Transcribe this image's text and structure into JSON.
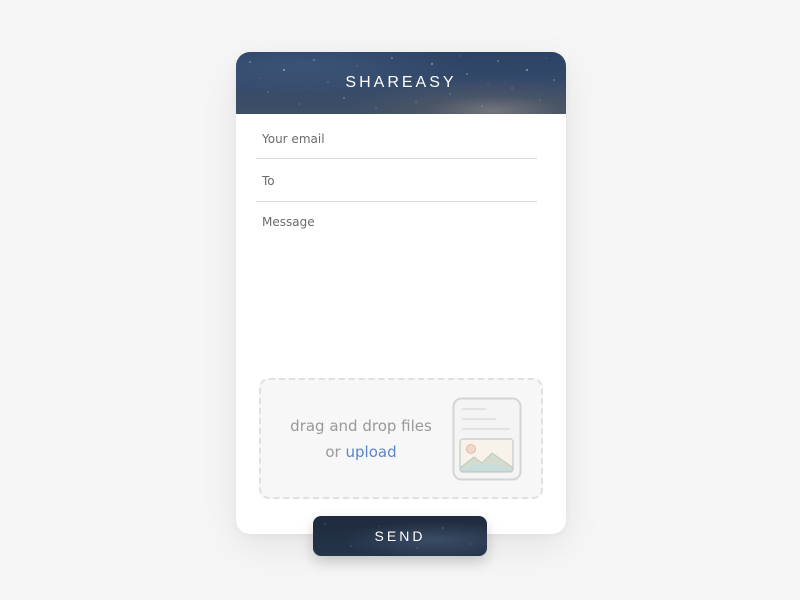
{
  "app": {
    "title": "SHAREASY"
  },
  "form": {
    "email_placeholder": "Your email",
    "to_placeholder": "To",
    "message_placeholder": "Message"
  },
  "dropzone": {
    "line1": "drag and drop files",
    "line2_prefix": "or",
    "upload_label": "upload"
  },
  "actions": {
    "send_label": "SEND"
  },
  "icons": {
    "file": "file-image-icon"
  },
  "colors": {
    "background": "#f6f6f6",
    "header_gradient_top": "#2c4262",
    "header_gradient_bottom": "#3e4f66",
    "link": "#5b86c9",
    "send_button": "#1f2b3d",
    "divider": "#dcdcdc",
    "dropzone_border": "#e0e0e0",
    "dropzone_text": "#999999"
  }
}
